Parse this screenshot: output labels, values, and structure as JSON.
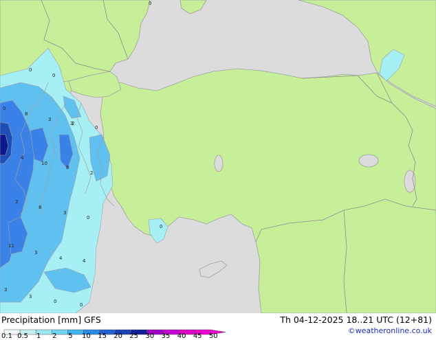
{
  "title": "Precipitation [mm] GFS",
  "valid_time": "Th 04-12-2025 18..21 UTC (12+81)",
  "credit": "©weatheronline.co.uk",
  "colors": {
    "sea": "#dcdcdc",
    "land_forecast": "#c7ef9a",
    "border": "#8c8c8c",
    "coast": "#a0a0a0",
    "precip_light": "#a6f0f5",
    "precip_mid": "#60c0f0",
    "precip_strong": "#3b82e8",
    "precip_heavy": "#1e4fb8",
    "precip_extreme": "#0a1a8a"
  },
  "legend": {
    "labels": [
      "0.1",
      "0.5",
      "1",
      "2",
      "5",
      "10",
      "15",
      "20",
      "25",
      "30",
      "35",
      "40",
      "45",
      "50"
    ],
    "colors": [
      "#eef8f8",
      "#c6f0f3",
      "#9be8f2",
      "#6ed6f4",
      "#3fb5ee",
      "#2a8ce8",
      "#1f63d6",
      "#1a40b8",
      "#0c1f98",
      "#a000c8",
      "#c800d8",
      "#e000c8",
      "#f000d0"
    ]
  },
  "contour_labels": [
    {
      "text": "0"
    },
    {
      "text": "0"
    },
    {
      "text": "0"
    },
    {
      "text": "0"
    },
    {
      "text": "3"
    },
    {
      "text": "8"
    },
    {
      "text": "3"
    },
    {
      "text": "2"
    },
    {
      "text": "0"
    },
    {
      "text": "4"
    },
    {
      "text": "10"
    },
    {
      "text": "8"
    },
    {
      "text": "2"
    },
    {
      "text": "3"
    },
    {
      "text": "8"
    },
    {
      "text": "3"
    },
    {
      "text": "0"
    },
    {
      "text": "11"
    },
    {
      "text": "3"
    },
    {
      "text": "4"
    },
    {
      "text": "4"
    },
    {
      "text": "3"
    },
    {
      "text": "3"
    },
    {
      "text": "0"
    },
    {
      "text": "0"
    },
    {
      "text": "0"
    }
  ]
}
